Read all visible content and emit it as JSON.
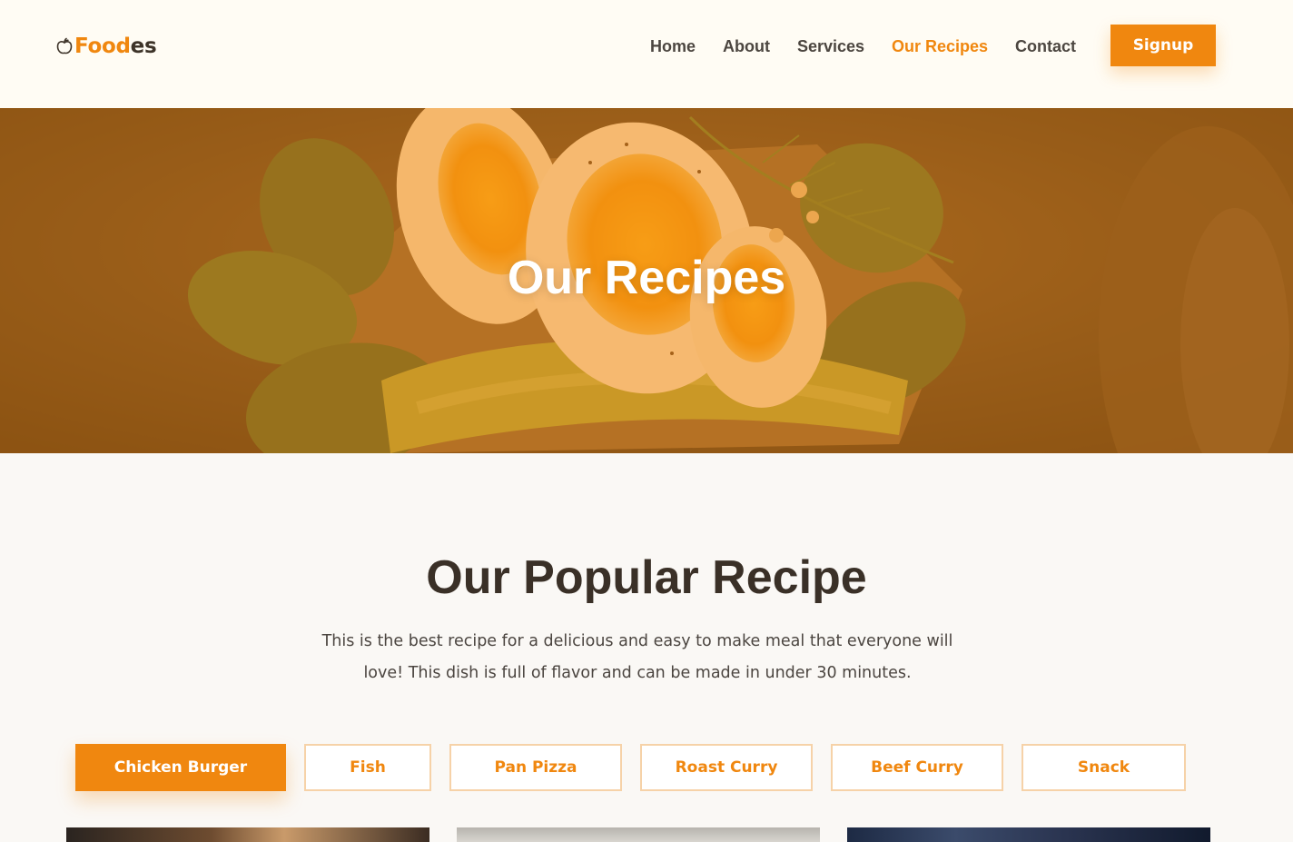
{
  "header": {
    "logo": {
      "part_a": "Food",
      "part_b": "es",
      "icon": "apple-icon"
    },
    "nav": [
      {
        "label": "Home",
        "active": false
      },
      {
        "label": "About",
        "active": false
      },
      {
        "label": "Services",
        "active": false
      },
      {
        "label": "Our Recipes",
        "active": true
      },
      {
        "label": "Contact",
        "active": false
      }
    ],
    "signup_label": "Signup"
  },
  "hero": {
    "title": "Our Recipes",
    "image": "boiled-eggs-avocado-spinach-toast"
  },
  "popular": {
    "title": "Our Popular Recipe",
    "description": "This is the best recipe for a delicious and easy to make meal that everyone will love! This dish is full of flavor and can be made in under 30 minutes.",
    "filters": [
      {
        "label": "Chicken Burger",
        "active": true
      },
      {
        "label": "Fish",
        "active": false
      },
      {
        "label": "Pan Pizza",
        "active": false
      },
      {
        "label": "Roast Curry",
        "active": false
      },
      {
        "label": "Beef Curry",
        "active": false
      },
      {
        "label": "Snack",
        "active": false
      }
    ]
  },
  "colors": {
    "accent": "#f0870f",
    "dark": "#3a3027",
    "header_bg": "#fffcf4",
    "page_bg": "#faf8f5"
  }
}
